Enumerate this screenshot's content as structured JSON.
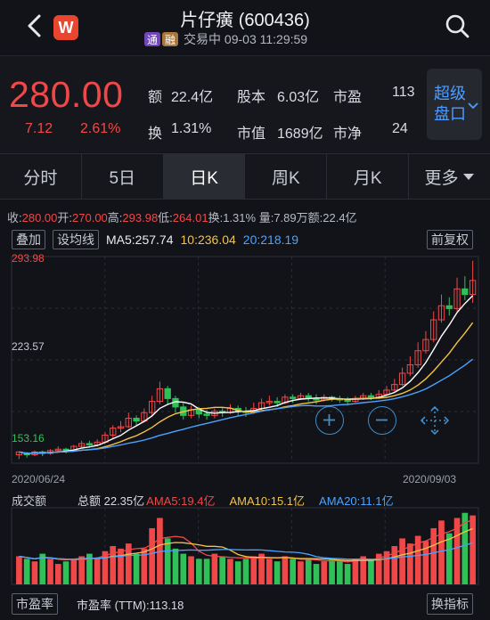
{
  "header": {
    "title": "片仔癀 (600436)",
    "badge_icon_letter": "W",
    "tags": [
      "通",
      "融"
    ],
    "status": "交易中 09-03 11:29:59"
  },
  "quote": {
    "price": "280.00",
    "change": "7.12",
    "change_pct": "2.61%",
    "amount_label": "额",
    "amount": "22.4亿",
    "turnover_label": "换",
    "turnover": "1.31%",
    "share_capital_label": "股本",
    "share_capital": "6.03亿",
    "market_value_label": "市值",
    "market_value": "1689亿",
    "pe_label": "市盈",
    "pe": "113",
    "pb_label": "市净",
    "pb": "24",
    "level2_button": "超级\n盘口"
  },
  "tabs": [
    "分时",
    "5日",
    "日K",
    "周K",
    "月K",
    "更多"
  ],
  "ohlc_line": {
    "close_label": "收:",
    "close": "280.00",
    "open_label": "开:",
    "open": "270.00",
    "high_label": "高:",
    "high": "293.98",
    "low_label": "低:",
    "low": "264.01",
    "turnover_label": "换:",
    "turnover": "1.31%",
    "volume_label": "量:",
    "volume": "7.89万",
    "amount_label": "额:",
    "amount": "22.4亿"
  },
  "kline_toolbar": {
    "overlay_button": "叠加",
    "ma_settings_button": "设均线",
    "ma5": "MA5:257.74",
    "ma10": "10:236.04",
    "ma20": "20:218.19",
    "adjust_button": "前复权"
  },
  "kline_axis": {
    "top": "293.98",
    "mid": "223.57",
    "bottom": "153.16"
  },
  "kline_dates": {
    "start": "2020/06/24",
    "end": "2020/09/03"
  },
  "volume_panel": {
    "title": "成交额",
    "total": "总额 22.35亿",
    "ama5": "AMA5:19.4亿",
    "ama10": "AMA10:15.1亿",
    "ama20": "AMA20:11.1亿"
  },
  "footer": {
    "indicator_button": "市盈率",
    "pe_ttm": "市盈率 (TTM):113.18",
    "switch_button": "换指标"
  },
  "colors": {
    "up": "#f04848",
    "down": "#2fc158",
    "ma5": "#ffffff",
    "ma10": "#f5c342",
    "ma20": "#4aa3ff"
  },
  "chart_data": {
    "type": "candlestick",
    "candles": [
      [
        156,
        158,
        153,
        157
      ],
      [
        157,
        156,
        154,
        158
      ],
      [
        156,
        158,
        155,
        159
      ],
      [
        158,
        157,
        155,
        159
      ],
      [
        157,
        159,
        156,
        160
      ],
      [
        159,
        160,
        158,
        162
      ],
      [
        160,
        159,
        157,
        161
      ],
      [
        159,
        162,
        158,
        163
      ],
      [
        162,
        164,
        161,
        166
      ],
      [
        164,
        163,
        161,
        166
      ],
      [
        163,
        165,
        162,
        167
      ],
      [
        165,
        170,
        164,
        172
      ],
      [
        170,
        175,
        168,
        177
      ],
      [
        175,
        176,
        172,
        180
      ],
      [
        176,
        182,
        175,
        186
      ],
      [
        182,
        180,
        177,
        184
      ],
      [
        180,
        186,
        179,
        189
      ],
      [
        186,
        194,
        184,
        198
      ],
      [
        194,
        203,
        192,
        208
      ],
      [
        203,
        196,
        192,
        205
      ],
      [
        196,
        190,
        186,
        198
      ],
      [
        190,
        184,
        181,
        193
      ],
      [
        184,
        188,
        182,
        191
      ],
      [
        188,
        185,
        182,
        190
      ],
      [
        185,
        184,
        181,
        188
      ],
      [
        184,
        187,
        182,
        189
      ],
      [
        187,
        186,
        183,
        190
      ],
      [
        186,
        189,
        185,
        192
      ],
      [
        189,
        187,
        184,
        191
      ],
      [
        187,
        186,
        183,
        190
      ],
      [
        186,
        189,
        185,
        193
      ],
      [
        189,
        193,
        188,
        196
      ],
      [
        193,
        194,
        191,
        198
      ],
      [
        194,
        193,
        190,
        197
      ],
      [
        193,
        197,
        192,
        199
      ],
      [
        197,
        196,
        193,
        199
      ],
      [
        196,
        198,
        195,
        200
      ],
      [
        198,
        196,
        194,
        200
      ],
      [
        196,
        195,
        192,
        199
      ],
      [
        195,
        197,
        194,
        199
      ],
      [
        197,
        196,
        194,
        198
      ],
      [
        196,
        195,
        193,
        198
      ],
      [
        195,
        194,
        191,
        197
      ],
      [
        194,
        196,
        193,
        198
      ],
      [
        196,
        198,
        195,
        200
      ],
      [
        198,
        197,
        195,
        200
      ],
      [
        197,
        199,
        196,
        202
      ],
      [
        199,
        202,
        198,
        205
      ],
      [
        202,
        206,
        201,
        210
      ],
      [
        206,
        214,
        205,
        218
      ],
      [
        214,
        220,
        212,
        226
      ],
      [
        220,
        230,
        218,
        236
      ],
      [
        230,
        238,
        228,
        244
      ],
      [
        238,
        252,
        236,
        258
      ],
      [
        252,
        262,
        250,
        270
      ],
      [
        262,
        260,
        255,
        268
      ],
      [
        260,
        274,
        258,
        282
      ],
      [
        274,
        270,
        266,
        283
      ],
      [
        270,
        280,
        264,
        294
      ]
    ],
    "ma5_last": 257.74,
    "ma10_last": 236.04,
    "ma20_last": 218.19,
    "ylim": [
      150,
      297
    ],
    "volume": [
      11,
      10,
      9,
      12,
      10,
      8,
      9,
      10,
      11,
      12,
      10,
      13,
      15,
      14,
      16,
      12,
      14,
      22,
      26,
      18,
      14,
      12,
      11,
      10,
      10,
      12,
      11,
      10,
      9,
      10,
      11,
      12,
      10,
      9,
      11,
      10,
      9,
      10,
      8,
      9,
      10,
      9,
      8,
      10,
      11,
      10,
      12,
      13,
      15,
      18,
      16,
      19,
      17,
      22,
      25,
      20,
      26,
      28,
      27
    ],
    "volume_ylim": [
      0,
      30
    ]
  }
}
